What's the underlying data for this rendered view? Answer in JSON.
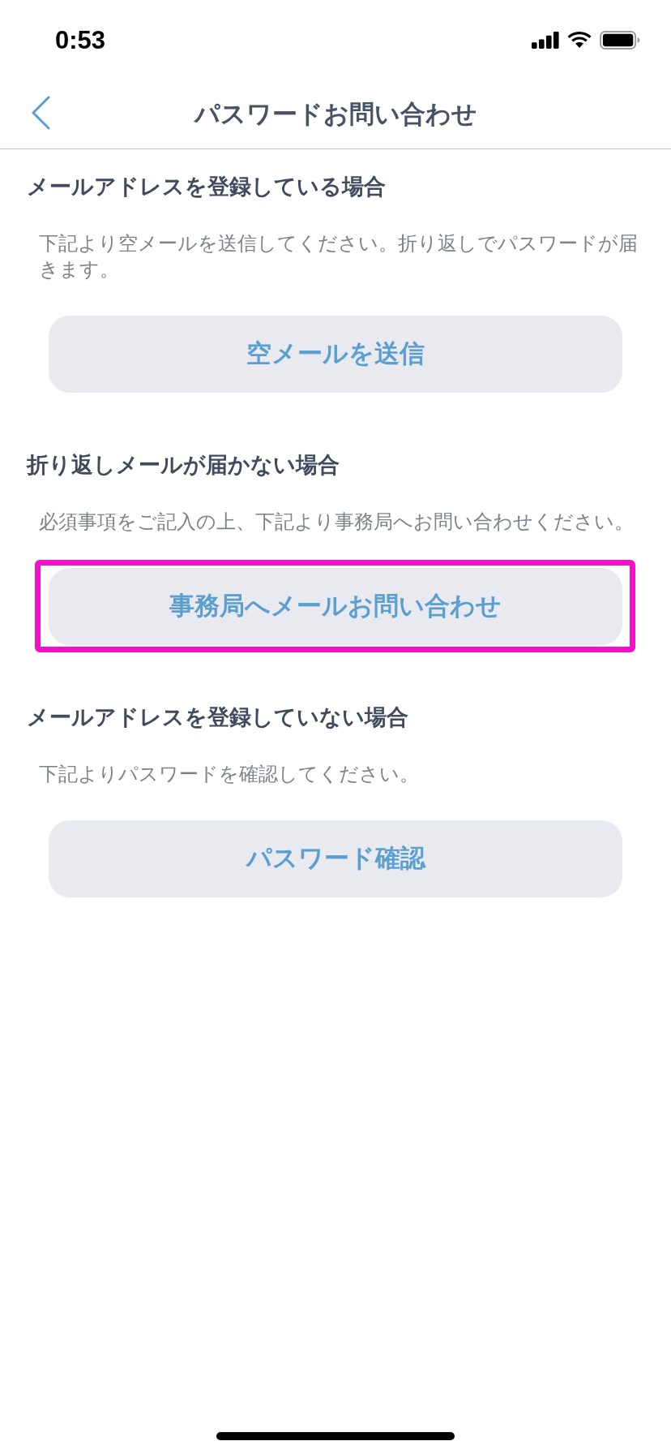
{
  "status_bar": {
    "time": "0:53"
  },
  "nav_bar": {
    "title": "パスワードお問い合わせ"
  },
  "sections": [
    {
      "heading": "メールアドレスを登録している場合",
      "description": "下記より空メールを送信してください。折り返しでパスワードが届きます。",
      "button": {
        "label": "空メールを送信",
        "highlighted": false
      }
    },
    {
      "heading": "折り返しメールが届かない場合",
      "description": "必須事項をご記入の上、下記より事務局へお問い合わせください。",
      "button": {
        "label": "事務局へメールお問い合わせ",
        "highlighted": true
      }
    },
    {
      "heading": "メールアドレスを登録していない場合",
      "description": "下記よりパスワードを確認してください。",
      "button": {
        "label": "パスワード確認",
        "highlighted": false
      }
    }
  ]
}
